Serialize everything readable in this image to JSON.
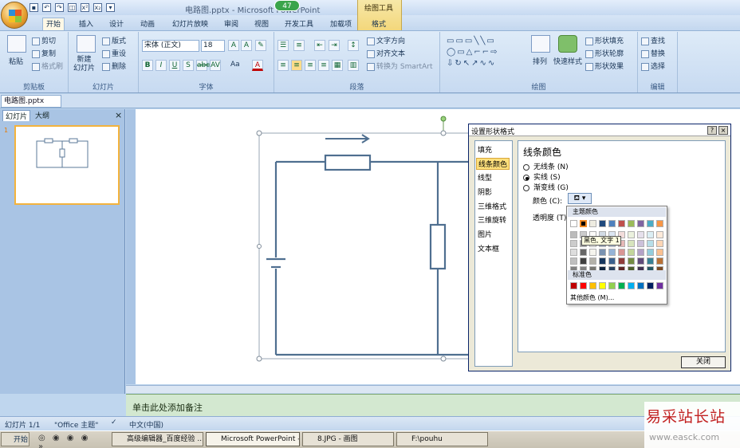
{
  "app": {
    "title": "电路图.pptx - Microsoft PowerPoint",
    "context_tab_group": "绘图工具",
    "notification_count": "47"
  },
  "tabs": [
    "开始",
    "插入",
    "设计",
    "动画",
    "幻灯片放映",
    "审阅",
    "视图",
    "开发工具",
    "加载项",
    "格式"
  ],
  "ribbon": {
    "clipboard": {
      "paste": "粘贴",
      "cut": "剪切",
      "copy": "复制",
      "painter": "格式刷",
      "label": "剪贴板"
    },
    "slides": {
      "new_slide": "新建\n幻灯片",
      "layout": "版式",
      "reset": "重设",
      "delete": "删除",
      "label": "幻灯片"
    },
    "font": {
      "name": "宋体 (正文)",
      "size": "18",
      "label": "字体",
      "case_btn": "Aa"
    },
    "paragraph": {
      "text_direction": "文字方向",
      "align_text": "对齐文本",
      "smartart": "转换为 SmartArt",
      "label": "段落"
    },
    "drawing": {
      "arrange": "排列",
      "quick_styles": "快速样式",
      "shape_fill": "形状填充",
      "shape_outline": "形状轮廓",
      "shape_effects": "形状效果",
      "label": "绘图"
    },
    "editing": {
      "find": "查找",
      "replace": "替换",
      "select": "选择",
      "label": "编辑"
    }
  },
  "document": {
    "tab_name": "电路图.pptx"
  },
  "left_pane": {
    "tab_slides": "幻灯片",
    "tab_outline": "大纲",
    "slide_number": "1"
  },
  "notes": {
    "placeholder": "单击此处添加备注"
  },
  "status": {
    "slide": "幻灯片 1/1",
    "theme": "\"Office 主题\"",
    "language": "中文(中国)"
  },
  "dialog": {
    "title": "设置形状格式",
    "help_btn": "?",
    "close_x": "×",
    "nav": [
      "填充",
      "线条颜色",
      "线型",
      "阴影",
      "三维格式",
      "三维旋转",
      "图片",
      "文本框"
    ],
    "selected_nav": "线条颜色",
    "panel_title": "线条颜色",
    "options": [
      "无线条 (N)",
      "实线 (S)",
      "渐变线 (G)"
    ],
    "selected_option": "实线 (S)",
    "color_label": "颜色 (C):",
    "transparency_label": "透明度 (T):",
    "close_button": "关闭"
  },
  "color_popup": {
    "theme_colors_label": "主题颜色",
    "standard_colors_label": "标准色",
    "more_colors": "其他颜色 (M)...",
    "tooltip": "黑色, 文字 1",
    "theme_top": [
      "#ffffff",
      "#000000",
      "#eeece1",
      "#1f497d",
      "#4f81bd",
      "#c0504d",
      "#9bbb59",
      "#8064a2",
      "#4bacc6",
      "#f79646"
    ],
    "standard": [
      "#c00000",
      "#ff0000",
      "#ffc000",
      "#ffff00",
      "#92d050",
      "#00b050",
      "#00b0f0",
      "#0070c0",
      "#002060",
      "#7030a0"
    ]
  },
  "taskbar": {
    "start": "开始",
    "items": [
      "高级编辑器_百度经验 ...",
      "Microsoft PowerPoint - [...",
      "8.JPG - 画图",
      "F:\\pouhu"
    ]
  },
  "watermark": {
    "text_cn": "易采站长站",
    "url": "www.easck.com"
  }
}
